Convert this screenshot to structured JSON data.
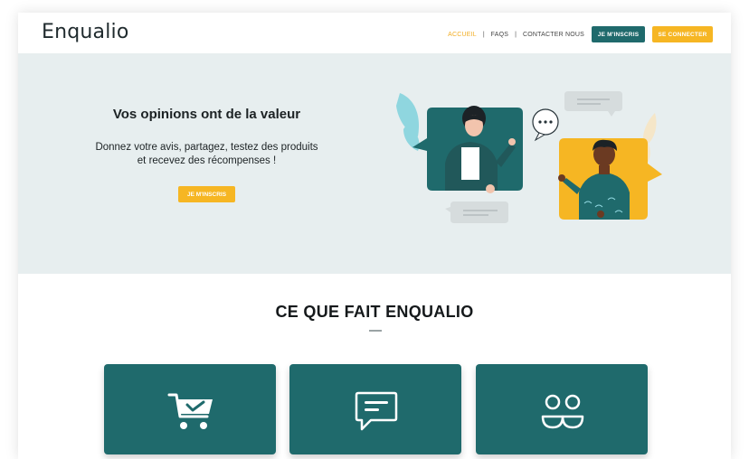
{
  "brand": {
    "logo_text": "Enqualio",
    "colors": {
      "teal": "#1f6a6c",
      "yellow": "#f6b623",
      "hero_bg": "#e7eeef"
    }
  },
  "nav": {
    "items": [
      {
        "label": "ACCUEIL",
        "active": true
      },
      {
        "label": "FAQS",
        "active": false
      },
      {
        "label": "CONTACTER NOUS",
        "active": false
      }
    ],
    "separator": "|",
    "signup_label": "JE M'INSCRIS",
    "login_label": "SE CONNECTER"
  },
  "hero": {
    "title": "Vos opinions ont de la valeur",
    "subtitle_line1": "Donnez votre avis, partagez, testez des produits",
    "subtitle_line2": "et recevez des récompenses !",
    "cta_label": "JE M'INSCRIS"
  },
  "section": {
    "title": "CE QUE FAIT ENQUALIO",
    "cards": [
      {
        "icon": "cart-check-icon"
      },
      {
        "icon": "chat-bubble-icon"
      },
      {
        "icon": "users-icon"
      }
    ]
  }
}
